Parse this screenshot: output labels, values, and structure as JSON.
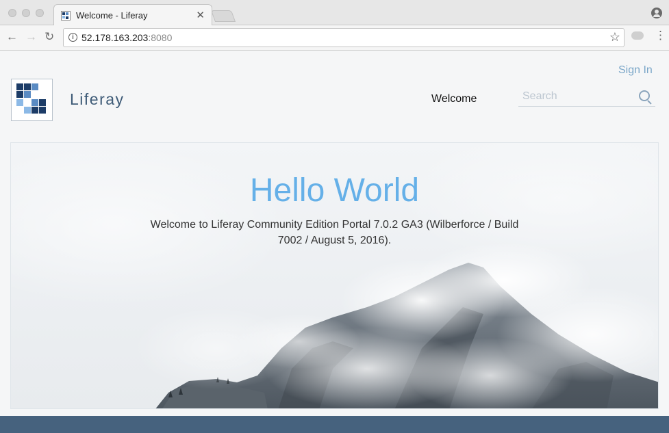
{
  "browser": {
    "tab_title": "Welcome - Liferay",
    "url_host": "52.178.163.203",
    "url_port": ":8080"
  },
  "header": {
    "sign_in": "Sign In",
    "brand": "Liferay",
    "nav": [
      "Welcome"
    ],
    "search_placeholder": "Search"
  },
  "hero": {
    "title": "Hello World",
    "subtitle": "Welcome to Liferay Community Edition Portal 7.0.2 GA3 (Wilberforce / Build 7002 / August 5, 2016)."
  },
  "colors": {
    "accent": "#65b0e8",
    "brand_text": "#3e5b77",
    "footer": "#46627e",
    "sign_in": "#7aa6c8"
  },
  "icons": [
    "back-icon",
    "forward-icon",
    "reload-icon",
    "info-icon",
    "star-icon",
    "extension-icon",
    "menu-icon",
    "profile-icon",
    "search-icon",
    "close-icon"
  ]
}
